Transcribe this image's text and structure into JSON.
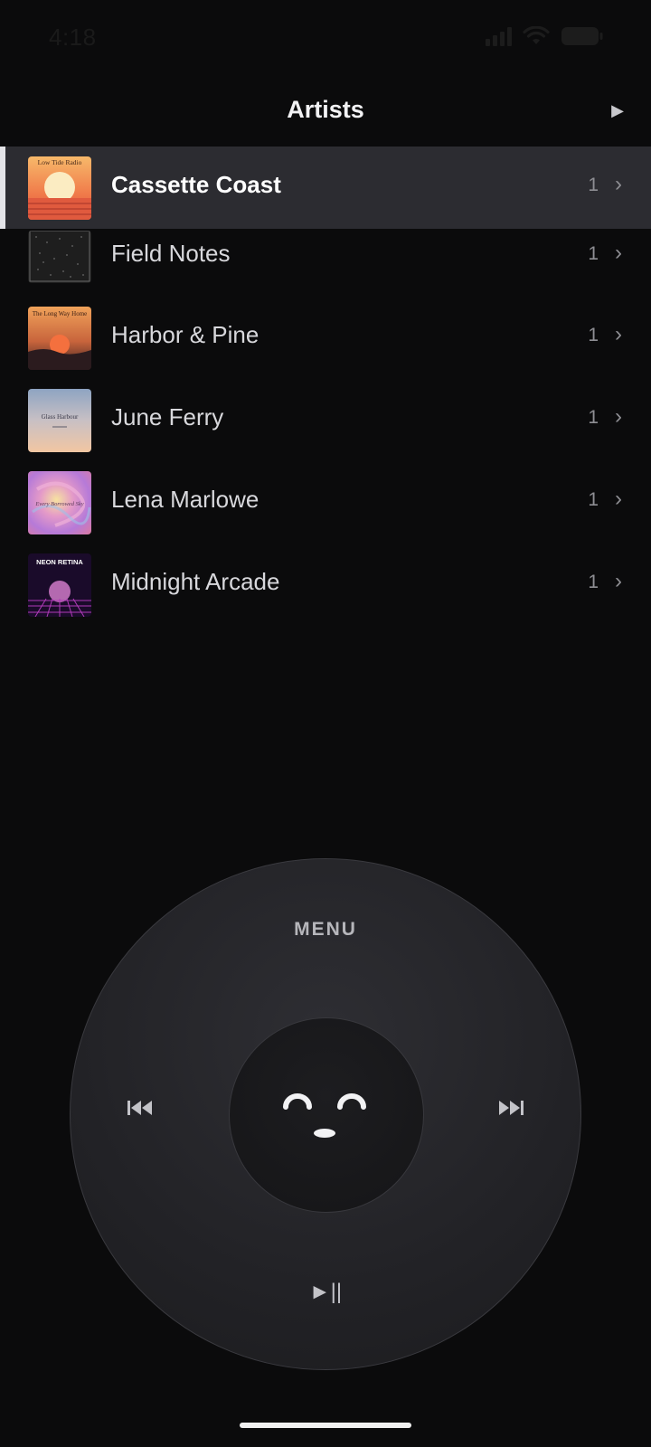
{
  "status_bar": {
    "time": "4:18",
    "icons": [
      "signal-icon",
      "wifi-icon",
      "battery-icon"
    ]
  },
  "header": {
    "title": "Artists",
    "right_icon": "play-icon"
  },
  "artists": [
    {
      "name": "Cassette Coast",
      "count": "1",
      "selected": true,
      "art": "sunset-orange"
    },
    {
      "name": "Field Notes",
      "count": "1",
      "selected": false,
      "art": "static-gray"
    },
    {
      "name": "Harbor & Pine",
      "count": "1",
      "selected": false,
      "art": "dusk-sun"
    },
    {
      "name": "June Ferry",
      "count": "1",
      "selected": false,
      "art": "pastel-sky"
    },
    {
      "name": "Lena Marlowe",
      "count": "1",
      "selected": false,
      "art": "swirl-pink"
    },
    {
      "name": "Midnight Arcade",
      "count": "1",
      "selected": false,
      "art": "neon-grid"
    }
  ],
  "art_text": {
    "cassette_coast": "Low Tide Radio",
    "harbor_pine": "The Long Way Home",
    "june_ferry": "Glass Harbour",
    "lena_marlowe": "Every Borrowed Sky",
    "midnight_arcade": "NEON RETINA"
  },
  "wheel": {
    "menu_label": "MENU",
    "play_pause_label": "►||",
    "prev_icon": "previous-track-icon",
    "next_icon": "next-track-icon",
    "center_icon": "face-icon"
  },
  "colors": {
    "background": "#0b0b0c",
    "selected_row": "#2c2c31",
    "wheel": "#242428"
  }
}
